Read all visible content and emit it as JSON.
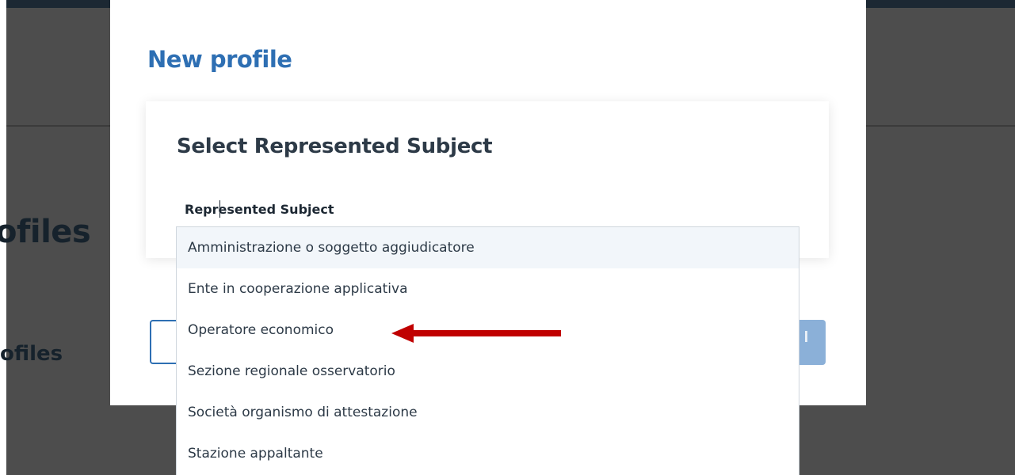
{
  "background_page": {
    "heading": "ofiles",
    "subheading": "ofiles"
  },
  "modal": {
    "title": "New profile",
    "card": {
      "title": "Select Represented Subject",
      "field_label": "Represented Subject"
    }
  },
  "dropdown": {
    "options": [
      "Amministrazione o soggetto aggiudicatore",
      "Ente in cooperazione applicativa",
      "Operatore economico",
      "Sezione regionale osservatorio",
      "Società organismo di attestazione",
      "Stazione appaltante"
    ],
    "highlighted_option": "Amministrazione o soggetto aggiudicatore"
  },
  "annotation": {
    "arrow_icon": "red-left-arrow-icon",
    "points_to": "Operatore economico",
    "color": "#c00000"
  },
  "colors": {
    "accent": "#2e6fb3",
    "overlay": "#4d4d4d",
    "highlight": "#f2f6fa"
  }
}
